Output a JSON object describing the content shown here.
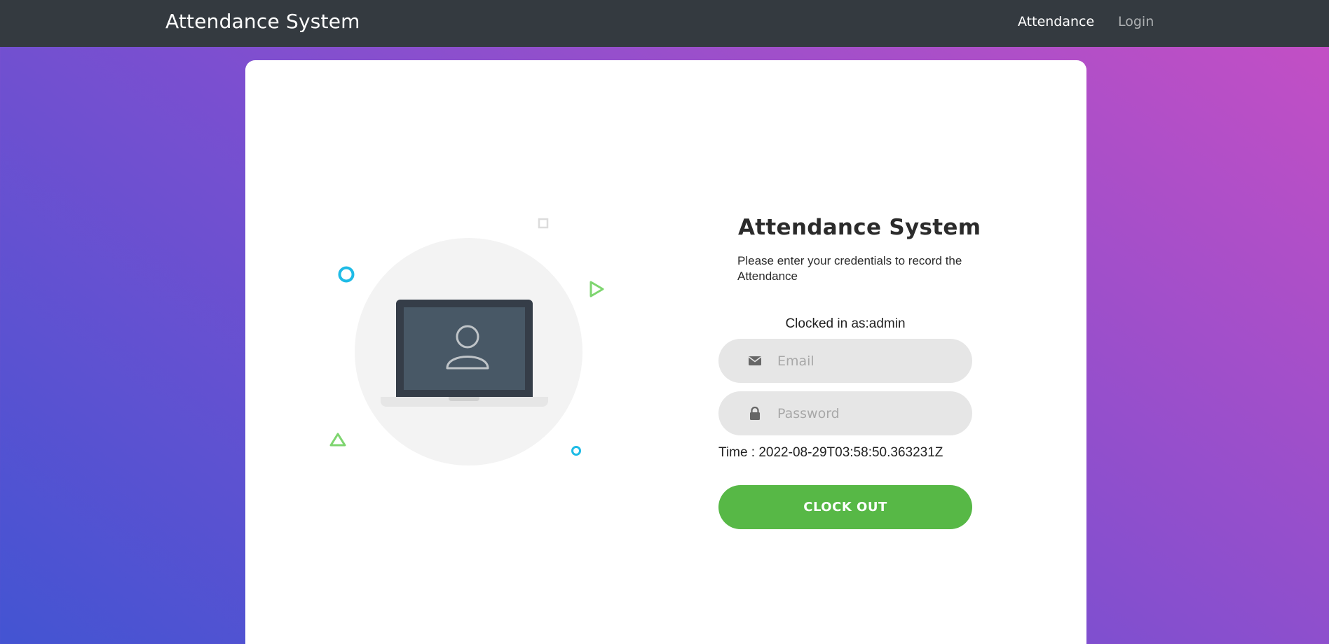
{
  "navbar": {
    "brand": "Attendance System",
    "links": [
      {
        "label": "Attendance",
        "active": true
      },
      {
        "label": "Login",
        "active": false
      }
    ]
  },
  "form": {
    "title": "Attendance System",
    "subtitle": "Please enter your credentials to record the Attendance",
    "status": "Clocked in as:admin",
    "email": {
      "placeholder": "Email",
      "value": "",
      "icon": "envelope-icon"
    },
    "password": {
      "placeholder": "Password",
      "value": "",
      "icon": "lock-icon"
    },
    "time": "Time : 2022-08-29T03:58:50.363231Z",
    "button_label": "CLOCK OUT"
  },
  "colors": {
    "navbar_bg": "#343a40",
    "button": "#57b846",
    "gradient_start": "#4354d2",
    "gradient_end": "#c74fc4",
    "accent_cyan": "#1ebbe6",
    "accent_green": "#7ed56f"
  }
}
